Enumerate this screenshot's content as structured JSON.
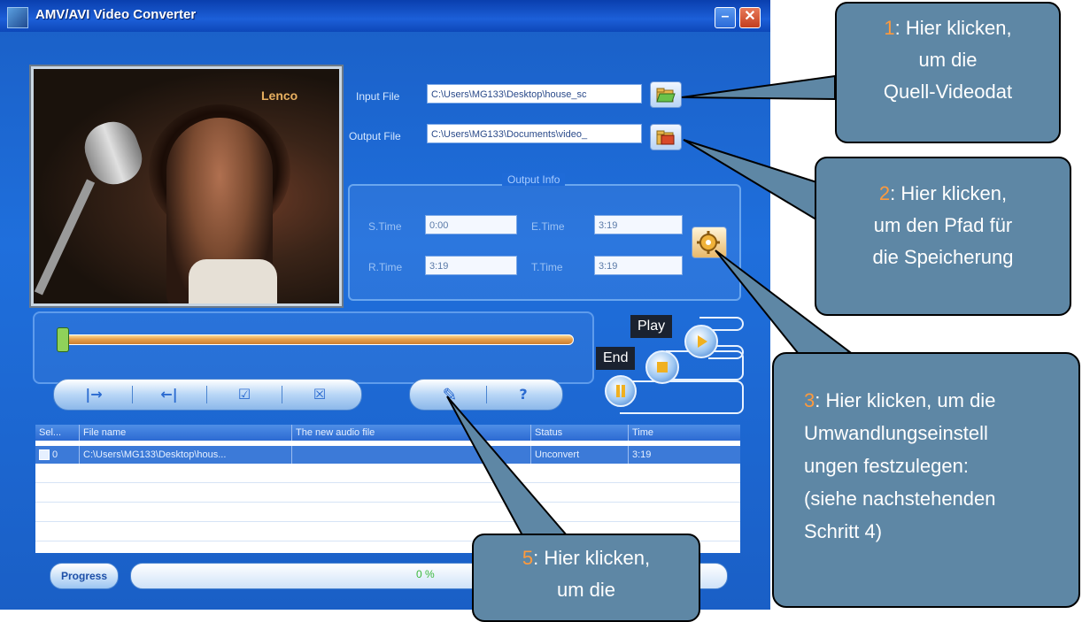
{
  "window": {
    "title": "AMV/AVI Video Converter",
    "minimize_glyph": "–",
    "close_glyph": "✕",
    "preview_logo": "Lenco"
  },
  "io": {
    "input_label": "Input File",
    "input_value": "C:\\Users\\MG133\\Desktop\\house_sc",
    "output_label": "Output File",
    "output_value": "C:\\Users\\MG133\\Documents\\video_"
  },
  "output_info": {
    "title": "Output Info",
    "stime_label": "S.Time",
    "stime_value": "0:00",
    "etime_label": "E.Time",
    "etime_value": "3:19",
    "rtime_label": "R.Time",
    "rtime_value": "3:19",
    "ttime_label": "T.Time",
    "ttime_value": "3:19"
  },
  "toolbar": {
    "set_start_glyph": "|→",
    "set_end_glyph": "←|",
    "check_glyph": "☑",
    "uncheck_glyph": "☒",
    "convert_glyph": "✎",
    "help_glyph": "?"
  },
  "tooltips": {
    "play": "Play",
    "end": "End"
  },
  "table": {
    "headers": [
      "Sel...",
      "File name",
      "The new audio file",
      "Status",
      "Time"
    ],
    "rows": [
      {
        "sel": "0",
        "file": "C:\\Users\\MG133\\Desktop\\hous...",
        "new_file": "",
        "status": "Unconvert",
        "time": "3:19"
      }
    ]
  },
  "progress": {
    "label": "Progress",
    "percent_text": "0 %",
    "value": 0
  },
  "callouts": {
    "c1": {
      "num": "1",
      "lines": [
        ": Hier klicken,",
        "um die",
        "Quell-Videodat"
      ]
    },
    "c2": {
      "num": "2",
      "lines": [
        ": Hier klicken,",
        "um den Pfad für",
        "die Speicherung"
      ]
    },
    "c3": {
      "num": "3",
      "lines": [
        ": Hier klicken, um die",
        "Umwandlungseinstell",
        "ungen festzulegen:",
        "(siehe nachstehenden",
        "Schritt 4)"
      ]
    },
    "c5": {
      "num": "5",
      "lines": [
        ": Hier klicken,",
        "um die"
      ]
    }
  },
  "colors": {
    "window_blue": "#1f6fdc",
    "callout_fill": "#5e87a5",
    "callout_number": "#ff9a3c"
  }
}
